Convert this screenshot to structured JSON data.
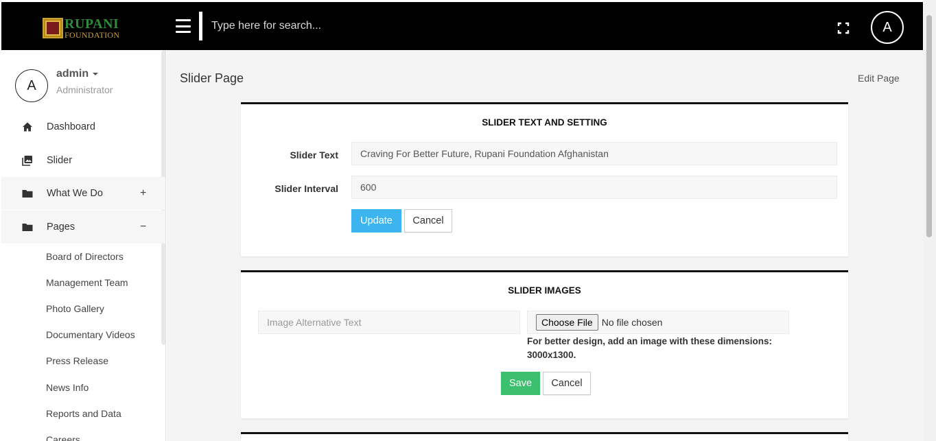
{
  "brand": {
    "name_line1": "RUPANI",
    "name_line2": "FOUNDATION"
  },
  "topbar": {
    "search_placeholder": "Type here for search...",
    "avatar_initial": "A",
    "menu_icon": "hamburger-icon",
    "fullscreen_icon": "fullscreen-icon"
  },
  "user": {
    "initial": "A",
    "name": "admin",
    "role": "Administrator"
  },
  "sidebar": {
    "items": [
      {
        "label": "Dashboard",
        "icon": "home-icon"
      },
      {
        "label": "Slider",
        "icon": "images-icon"
      },
      {
        "label": "What We Do",
        "icon": "folder-icon",
        "toggle": "+"
      },
      {
        "label": "Pages",
        "icon": "folder-icon",
        "toggle": "−"
      }
    ],
    "subitems": [
      "Board of Directors",
      "Management Team",
      "Photo Gallery",
      "Documentary Videos",
      "Press Release",
      "News Info",
      "Reports and Data",
      "Careers"
    ]
  },
  "main": {
    "title": "Slider Page",
    "edit_link": "Edit Page"
  },
  "slider_settings": {
    "heading": "SLIDER TEXT AND SETTING",
    "text_label": "Slider Text",
    "text_value": "Craving For Better Future, Rupani Foundation Afghanistan",
    "interval_label": "Slider Interval",
    "interval_value": "600",
    "update_label": "Update",
    "cancel_label": "Cancel"
  },
  "slider_images": {
    "heading": "SLIDER IMAGES",
    "alt_placeholder": "Image Alternative Text",
    "choose_file_label": "Choose File",
    "file_status": "No file chosen",
    "hint": "For better design, add an image with these dimensions: 3000x1300.",
    "save_label": "Save",
    "cancel_label": "Cancel"
  },
  "colors": {
    "topbar": "#000000",
    "update_button": "#3cb4f0",
    "save_button": "#3cbf6e",
    "logo_green": "#2e8b3a",
    "logo_gold": "#c9a13c"
  }
}
